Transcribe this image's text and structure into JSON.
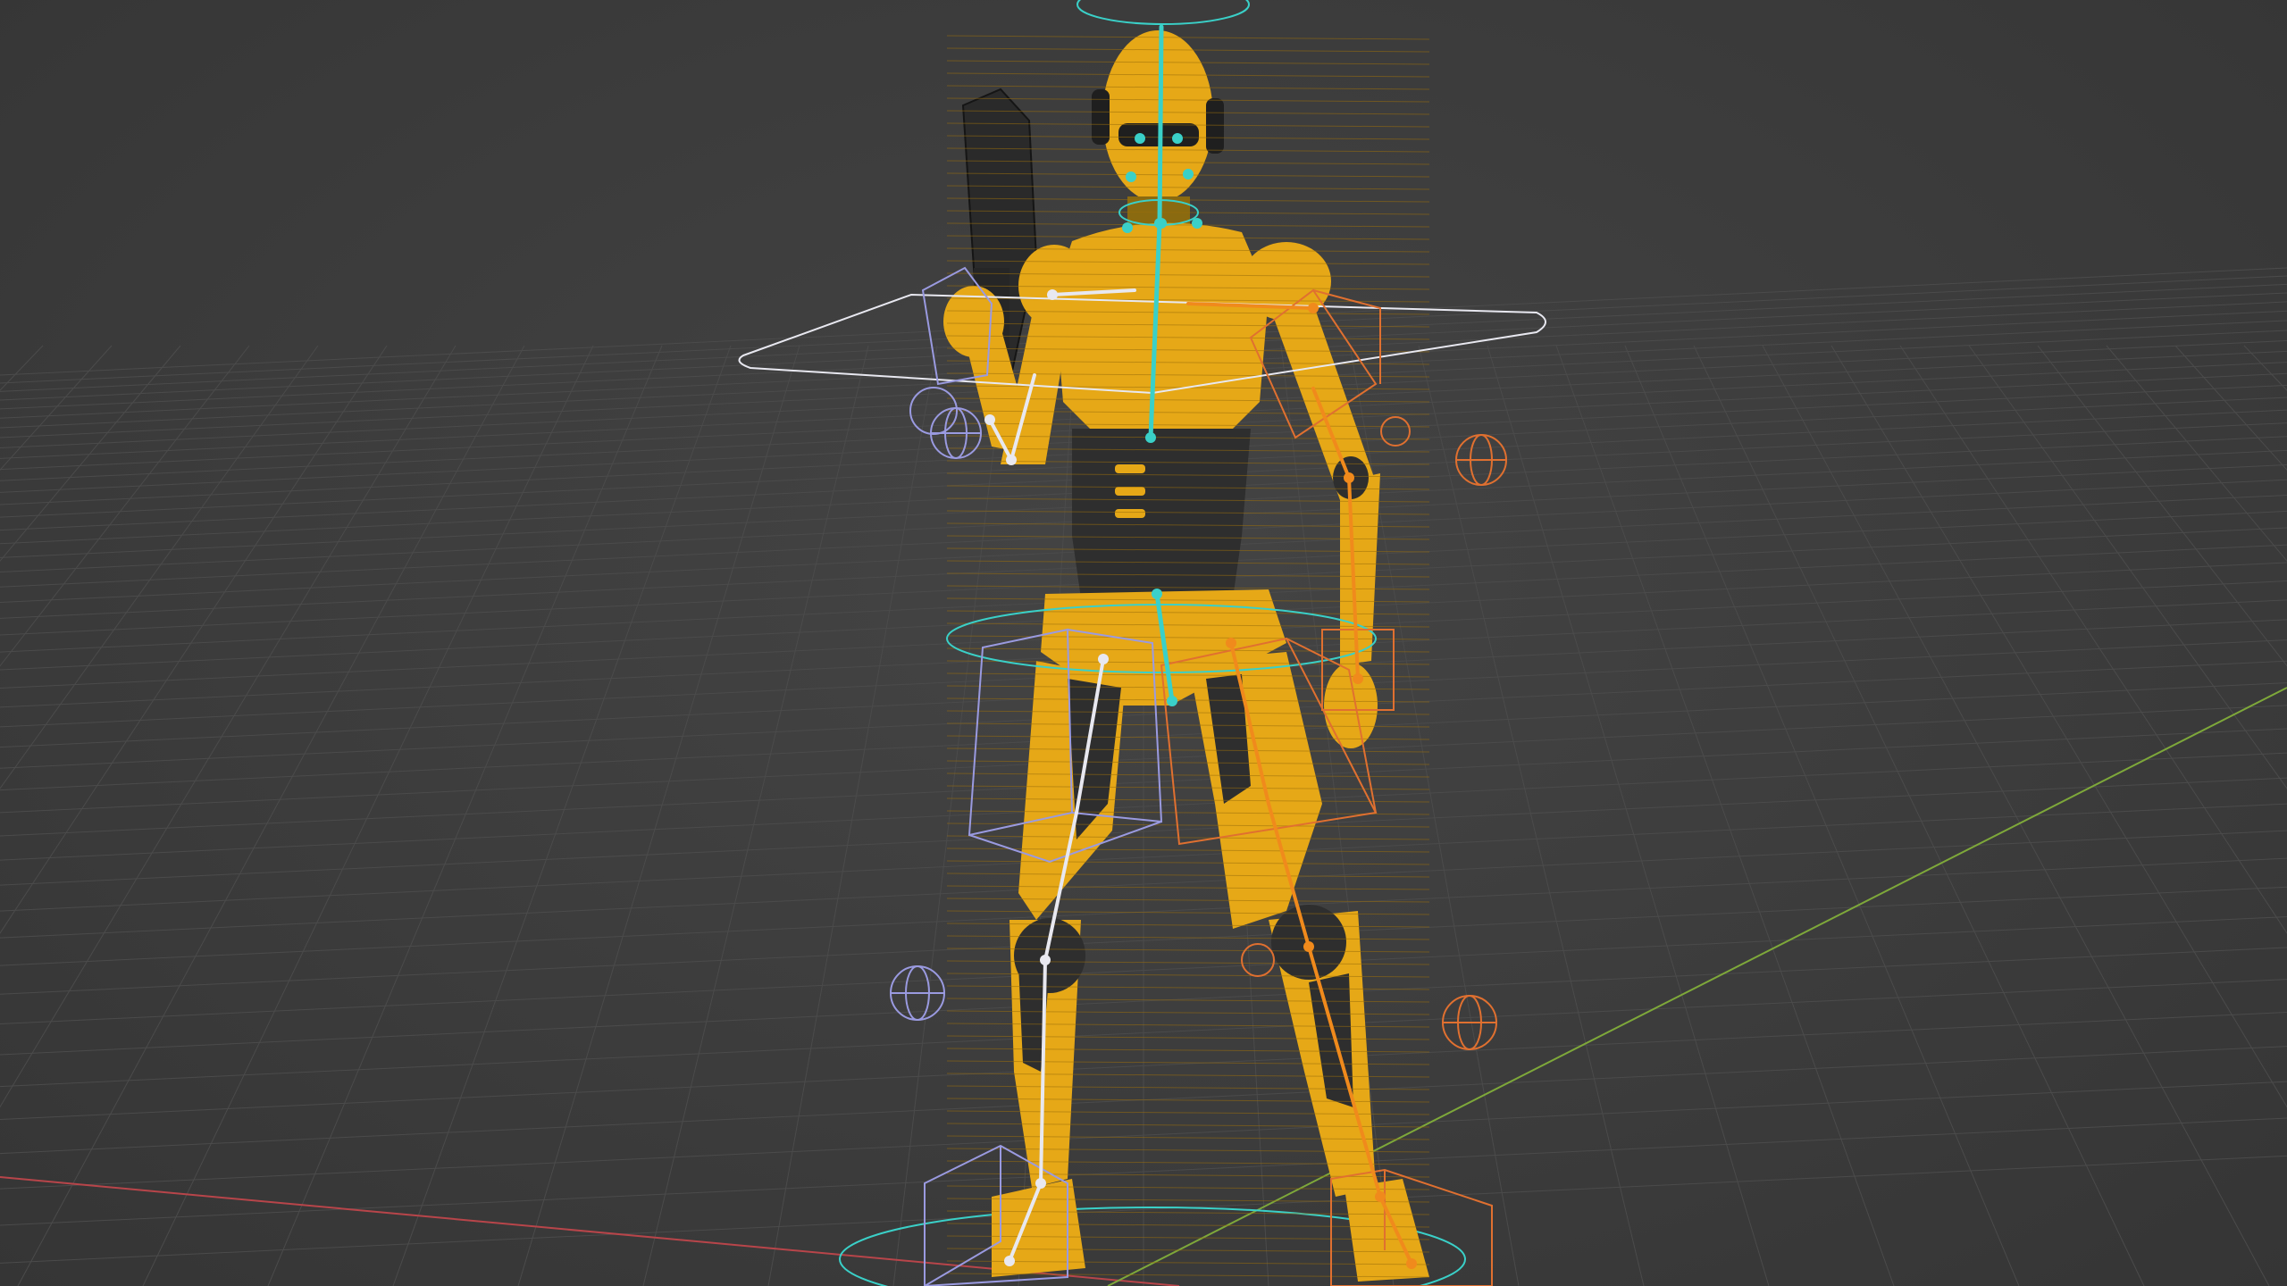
{
  "viewport": {
    "label": "3D Viewport",
    "colors": {
      "background": "#3c3c3c",
      "grid": "#4a4a4a",
      "x_axis": "#c0454a",
      "y_axis": "#7ea83a",
      "mesh_yellow": "#e6a817",
      "mesh_dark": "#2e2e2e",
      "bone_cyan": "#3ad0c8",
      "bone_white": "#e8e8f0",
      "bone_orange": "#f08a1c",
      "control_lavender": "#a8a8e8",
      "control_orange": "#e07030"
    }
  },
  "scene": {
    "object": "rigged-robot-character",
    "armature": "armature-rig"
  }
}
